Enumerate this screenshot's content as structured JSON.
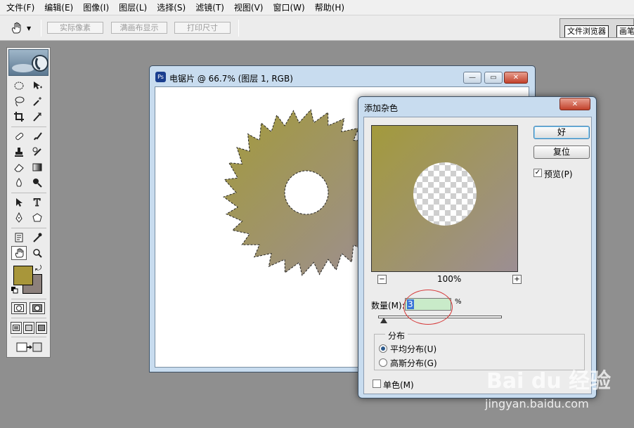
{
  "menu": [
    "文件(F)",
    "编辑(E)",
    "图像(I)",
    "图层(L)",
    "选择(S)",
    "滤镜(T)",
    "视图(V)",
    "窗口(W)",
    "帮助(H)"
  ],
  "options_bar": {
    "tool_icon": "hand-icon",
    "buttons": [
      "实际像素",
      "满画布显示",
      "打印尺寸"
    ],
    "palette_tabs": [
      "文件浏览器",
      "画笔"
    ]
  },
  "toolbox": {
    "foreground_color": "#a8963a",
    "background_color": "#8c807c"
  },
  "document": {
    "title": "电锯片 @ 66.7% (图层 1, RGB)",
    "blade_color_start": "#a39a3c",
    "blade_color_end": "#9c8e94"
  },
  "dialog": {
    "title": "添加杂色",
    "close_label": "✕",
    "ok_label": "好",
    "reset_label": "复位",
    "preview_label": "预览(P)",
    "preview_checked": true,
    "zoom": "100%",
    "zoom_out": "−",
    "zoom_in": "+",
    "amount_label": "数量(M):",
    "amount_value": "3",
    "amount_unit": "%",
    "distribution_label": "分布",
    "uniform_label": "平均分布(U)",
    "gaussian_label": "高斯分布(G)",
    "selected_distribution": "uniform",
    "monochrome_label": "单色(M)",
    "monochrome_checked": false
  },
  "watermark": {
    "brand": "Bai du 经验",
    "url": "jingyan.baidu.com"
  }
}
